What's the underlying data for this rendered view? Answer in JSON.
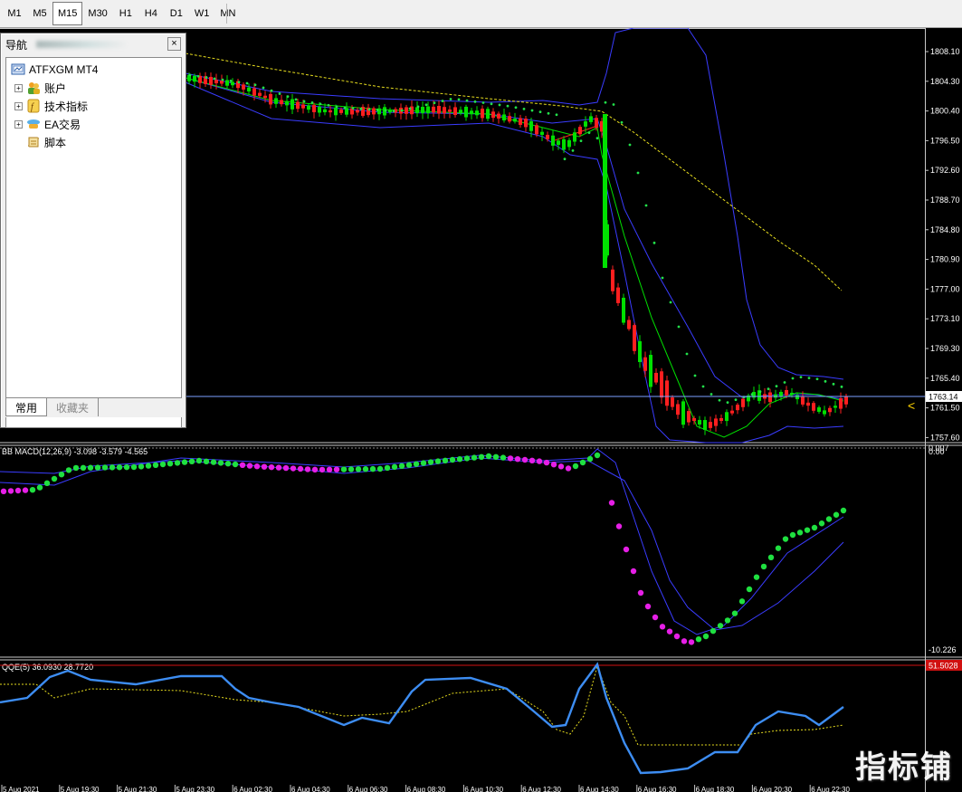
{
  "toolbar": {
    "timeframes": [
      "M1",
      "M5",
      "M15",
      "M30",
      "H1",
      "H4",
      "D1",
      "W1",
      "MN"
    ],
    "active": "M15"
  },
  "navigator": {
    "title": "导航",
    "close": "×",
    "root": "ATFXGM MT4",
    "items": [
      "账户",
      "技术指标",
      "EA交易",
      "脚本"
    ],
    "tabs": [
      "常用",
      "收藏夹"
    ]
  },
  "main_chart": {
    "price_labels": [
      "1808.10",
      "1804.30",
      "1800.40",
      "1796.50",
      "1792.60",
      "1788.70",
      "1784.80",
      "1780.90",
      "1777.00",
      "1773.10",
      "1769.30",
      "1765.40",
      "1761.50",
      "1757.60"
    ],
    "current_price": "1763.14",
    "current_marker": "<"
  },
  "macd_panel": {
    "label": "BB MACD(12,26,9) -3.098 -3.579 -4.565",
    "scale": [
      "0.007",
      "0.00",
      "-10.226"
    ]
  },
  "qqe_panel": {
    "label": "QQE(5) 36.0930 28.7720",
    "level": "51.5028",
    "bottom_tick": "3"
  },
  "time_axis": [
    "5 Aug 2021",
    "5 Aug 19:30",
    "5 Aug 21:30",
    "5 Aug 23:30",
    "6 Aug 02:30",
    "6 Aug 04:30",
    "6 Aug 06:30",
    "6 Aug 08:30",
    "6 Aug 10:30",
    "6 Aug 12:30",
    "6 Aug 14:30",
    "6 Aug 16:30",
    "6 Aug 18:30",
    "6 Aug 20:30",
    "6 Aug 22:30"
  ],
  "watermark": "指标铺",
  "colors": {
    "bull": "#00e000",
    "bear": "#ff1f1f",
    "band": "#3a3cff",
    "sar": "#22e04a",
    "ma_slow": "#e6dc1e",
    "macd_up": "#1fe040",
    "macd_down": "#e61fe6",
    "qqe_fast": "#3d8df2",
    "qqe_slow": "#e6dc1e",
    "level_line": "#d01010"
  }
}
